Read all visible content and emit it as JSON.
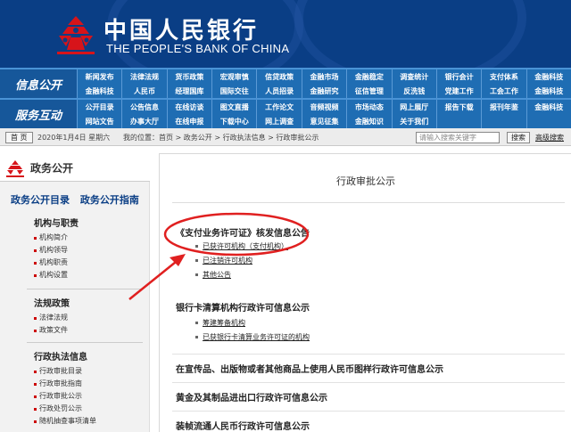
{
  "header": {
    "title_cn": "中国人民银行",
    "title_en": "THE PEOPLE'S BANK OF CHINA"
  },
  "nav": {
    "section1": "信息公开",
    "section2": "服务互动",
    "row1": [
      "新闻发布",
      "法律法规",
      "货币政策",
      "宏观审慎",
      "信贷政策",
      "金融市场",
      "金融稳定",
      "调查统计",
      "银行会计",
      "支付体系",
      "金融科技"
    ],
    "row2": [
      "金融科技",
      "人民币",
      "经理国库",
      "国际交往",
      "人员招录",
      "金融研究",
      "征信管理",
      "反洗钱",
      "党建工作",
      "工会工作",
      "金融科技"
    ],
    "row3": [
      "公开目录",
      "公告信息",
      "在线访谈",
      "图文直播",
      "工作论文",
      "音频视频",
      "市场动态",
      "网上展厅",
      "报告下载",
      "报刊年鉴",
      "金融科技"
    ],
    "row4": [
      "网站文告",
      "办事大厅",
      "在线申报",
      "下载中心",
      "网上调查",
      "意见征集",
      "金融知识",
      "关于我们",
      "",
      "",
      ""
    ]
  },
  "locbar": {
    "home": "首 页",
    "date": "2020年1月4日 星期六",
    "path": "我的位置：首页 > 政务公开 > 行政执法信息 > 行政审批公示",
    "search_placeholder": "请输入搜索关键字",
    "search_button": "搜索",
    "advanced": "高级搜索"
  },
  "sidebar": {
    "title": "政务公开",
    "link1": "政务公开目录",
    "link2": "政务公开指南",
    "group1": {
      "title": "机构与职责",
      "items": [
        "机构简介",
        "机构领导",
        "机构职责",
        "机构设置"
      ]
    },
    "group2": {
      "title": "法规政策",
      "items": [
        "法律法规",
        "政策文件"
      ]
    },
    "group3": {
      "title": "行政执法信息",
      "items": [
        "行政审批目录",
        "行政审批指南",
        "行政审批公示",
        "行政处罚公示",
        "随机抽查事项清单"
      ]
    }
  },
  "main": {
    "title": "行政审批公示",
    "section1": {
      "title": "《支付业务许可证》核发信息公告",
      "items": [
        "已获许可机构（支付机构）",
        "已注销许可机构",
        "其他公告"
      ]
    },
    "section2": {
      "title": "银行卡清算机构行政许可信息公示",
      "items": [
        "筹建筹备机构",
        "已获银行卡清算业务许可证的机构"
      ]
    },
    "section3": {
      "title": "在宣传品、出版物或者其他商品上使用人民币图样行政许可信息公示"
    },
    "section4": {
      "title": "黄金及其制品进出口行政许可信息公示"
    },
    "section5": {
      "title": "装帧流通人民币行政许可信息公示"
    }
  },
  "colors": {
    "header_bg": "#0a3e85",
    "nav_bg": "#1f6db3",
    "logo_red": "#d7141a",
    "annotation_red": "#e02020"
  }
}
